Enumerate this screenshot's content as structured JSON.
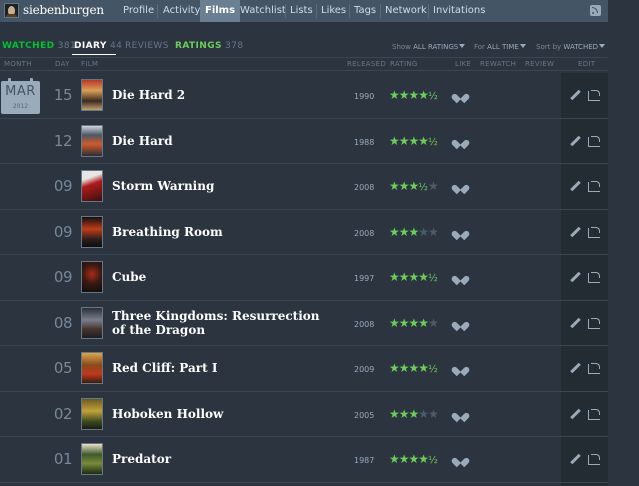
{
  "user": {
    "name": "siebenburgen"
  },
  "nav": [
    "Profile",
    "Activity",
    "Films",
    "Watchlist",
    "Lists",
    "Likes",
    "Tags",
    "Network",
    "Invitations"
  ],
  "active_nav": "Films",
  "subtabs": {
    "watched": {
      "label": "WATCHED",
      "count": "381"
    },
    "diary": {
      "label": "DIARY",
      "count": "44"
    },
    "reviews": {
      "label": "REVIEWS"
    },
    "ratings": {
      "label": "RATINGS",
      "count": "378"
    }
  },
  "filters": {
    "show_label": "Show",
    "show_value": "ALL RATINGS",
    "for_label": "For",
    "for_value": "ALL TIME",
    "sort_label": "Sort by",
    "sort_value": "WATCHED"
  },
  "columns": {
    "month": "MONTH",
    "day": "DAY",
    "film": "FILM",
    "released": "RELEASED",
    "rating": "RATING",
    "like": "LIKE",
    "rewatch": "REWATCH",
    "review": "REVIEW",
    "edit": "EDIT"
  },
  "calendar": {
    "month": "MAR",
    "year": "2012"
  },
  "entries": [
    {
      "day": "15",
      "title": "Die Hard 2",
      "year": "1990",
      "rating": 4.5,
      "liked": true
    },
    {
      "day": "12",
      "title": "Die Hard",
      "year": "1988",
      "rating": 4.5,
      "liked": true
    },
    {
      "day": "09",
      "title": "Storm Warning",
      "year": "2008",
      "rating": 3.5,
      "liked": true
    },
    {
      "day": "09",
      "title": "Breathing Room",
      "year": "2008",
      "rating": 3,
      "liked": true
    },
    {
      "day": "09",
      "title": "Cube",
      "year": "1997",
      "rating": 4.5,
      "liked": true
    },
    {
      "day": "08",
      "title": "Three Kingdoms: Resurrection of the Dragon",
      "year": "2008",
      "rating": 4,
      "liked": true
    },
    {
      "day": "05",
      "title": "Red Cliff: Part I",
      "year": "2009",
      "rating": 4.5,
      "liked": true
    },
    {
      "day": "02",
      "title": "Hoboken Hollow",
      "year": "2005",
      "rating": 3,
      "liked": true
    },
    {
      "day": "01",
      "title": "Predator",
      "year": "1987",
      "rating": 4.5,
      "liked": true
    }
  ],
  "colors": {
    "background": "#2c3440",
    "nav_bar": "#445566",
    "nav_active": "#6b7f93",
    "watched_green": "#00c030",
    "ratings_green": "#6bcd5a",
    "star_green": "#6bcd5a"
  }
}
